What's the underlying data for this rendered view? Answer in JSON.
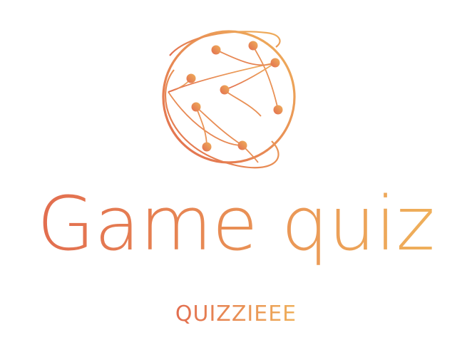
{
  "logo": {
    "icon": "network-globe-icon",
    "gradient_start": "#e26d4f",
    "gradient_end": "#efb05b"
  },
  "title": "Game quiz",
  "subtitle": "QUIZZIEEE"
}
